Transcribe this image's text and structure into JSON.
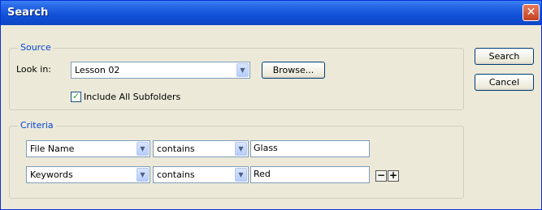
{
  "window": {
    "title": "Search"
  },
  "source": {
    "legend": "Source",
    "look_in_label": "Look in:",
    "look_in_value": "Lesson 02",
    "browse_label": "Browse...",
    "include_subfolders_label": "Include All Subfolders",
    "include_subfolders_checked": true
  },
  "criteria": {
    "legend": "Criteria",
    "rows": [
      {
        "field": "File Name",
        "operator": "contains",
        "value": "Glass"
      },
      {
        "field": "Keywords",
        "operator": "contains",
        "value": "Red"
      }
    ],
    "remove_label": "−",
    "add_label": "+"
  },
  "actions": {
    "search_label": "Search",
    "cancel_label": "Cancel"
  },
  "icons": {
    "close": "close-icon",
    "dropdown": "chevron-down-icon",
    "check": "check-icon"
  }
}
